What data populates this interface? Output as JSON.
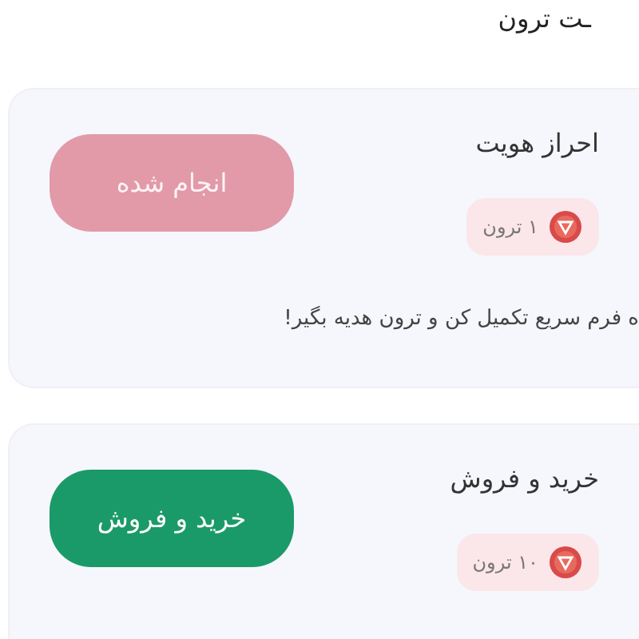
{
  "header": {
    "title": "ـت ترون"
  },
  "tasks": [
    {
      "title": "احراز هویت",
      "reward": "۱ ترون",
      "button": "انجام شده",
      "done": true,
      "description": "ه فرم سریع تکمیل کن و ترون هدیه بگیر!"
    },
    {
      "title": "خرید و فروش",
      "reward": "۱۰ ترون",
      "button": "خرید و فروش",
      "done": false
    }
  ]
}
